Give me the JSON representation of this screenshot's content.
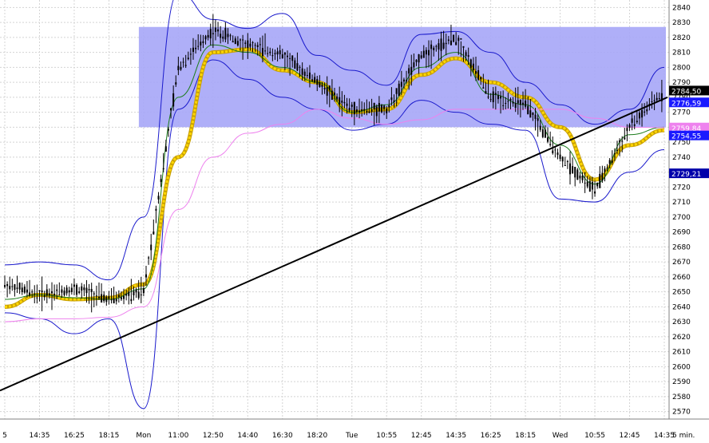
{
  "chart_data": {
    "type": "candlestick",
    "title": "",
    "xlabel": "",
    "ylabel": "",
    "ylim": [
      2565,
      2845
    ],
    "y_ticks": [
      2570,
      2580,
      2590,
      2600,
      2610,
      2620,
      2630,
      2640,
      2650,
      2660,
      2670,
      2680,
      2690,
      2700,
      2710,
      2720,
      2730,
      2740,
      2750,
      2760,
      2770,
      2780,
      2790,
      2800,
      2810,
      2820,
      2830,
      2840
    ],
    "x_ticks": [
      "5",
      "14:35",
      "16:25",
      "18:15",
      "Mon",
      "11:00",
      "12:50",
      "14:40",
      "16:30",
      "18:20",
      "Tue",
      "10:55",
      "12:45",
      "14:35",
      "16:25",
      "18:15",
      "Wed",
      "10:55",
      "12:45",
      "14:35"
    ],
    "timeframe_label": "5 min.",
    "zone": {
      "from": 2760,
      "to": 2827,
      "color": "#a6a6f7"
    },
    "trendline": {
      "start_price": 2584,
      "end_price": 2780,
      "color": "#000000"
    },
    "price_labels": [
      {
        "text": "2784,50",
        "value": 2784.5,
        "bg": "#000000",
        "fg": "#ffffff"
      },
      {
        "text": "2776,59",
        "value": 2776.6,
        "bg": "#1a1aff",
        "fg": "#ffffff"
      },
      {
        "text": "2759,84",
        "value": 2759.8,
        "bg": "#ee82ee",
        "fg": "#ffffff"
      },
      {
        "text": "2754,55",
        "value": 2754.5,
        "bg": "#1a1aff",
        "fg": "#ffffff"
      },
      {
        "text": "2729,21",
        "value": 2729.2,
        "bg": "#0000aa",
        "fg": "#ffffff"
      }
    ],
    "series": [
      {
        "role": "price",
        "style": "candles",
        "x": [
          "5",
          "14:35",
          "16:25",
          "18:15",
          "Mon",
          "11:00",
          "12:50",
          "14:40",
          "16:30",
          "18:20",
          "Tue",
          "10:55",
          "12:45",
          "14:35",
          "16:25",
          "18:15",
          "Wed",
          "10:55",
          "12:45",
          "14:35"
        ],
        "values": [
          2655,
          2648,
          2652,
          2645,
          2650,
          2800,
          2825,
          2815,
          2808,
          2790,
          2772,
          2772,
          2808,
          2820,
          2780,
          2775,
          2740,
          2718,
          2760,
          2784
        ]
      },
      {
        "role": "bollinger-upper",
        "color": "#1a1acc",
        "values": [
          2668,
          2670,
          2668,
          2658,
          2700,
          2850,
          2832,
          2826,
          2836,
          2808,
          2798,
          2788,
          2822,
          2824,
          2810,
          2790,
          2775,
          2762,
          2772,
          2800
        ]
      },
      {
        "role": "bollinger-lower",
        "color": "#1a1acc",
        "values": [
          2636,
          2632,
          2622,
          2632,
          2572,
          2772,
          2805,
          2792,
          2780,
          2772,
          2758,
          2762,
          2778,
          2770,
          2762,
          2758,
          2712,
          2710,
          2730,
          2745
        ]
      },
      {
        "role": "ma-fast",
        "color": "#ffd700",
        "values": [
          2640,
          2648,
          2645,
          2646,
          2655,
          2740,
          2810,
          2812,
          2798,
          2790,
          2770,
          2772,
          2795,
          2806,
          2790,
          2780,
          2760,
          2725,
          2748,
          2758
        ]
      },
      {
        "role": "ma-mid",
        "color": "#1c7d1c",
        "values": [
          2645,
          2648,
          2646,
          2645,
          2652,
          2780,
          2815,
          2810,
          2800,
          2790,
          2770,
          2775,
          2800,
          2810,
          2782,
          2775,
          2748,
          2722,
          2755,
          2760
        ]
      },
      {
        "role": "ma-slow",
        "color": "#ee82ee",
        "values": [
          2630,
          2632,
          2632,
          2633,
          2640,
          2705,
          2740,
          2756,
          2762,
          2772,
          2766,
          2762,
          2765,
          2772,
          2772,
          2772,
          2772,
          2766,
          2760,
          2759.8
        ]
      }
    ]
  }
}
